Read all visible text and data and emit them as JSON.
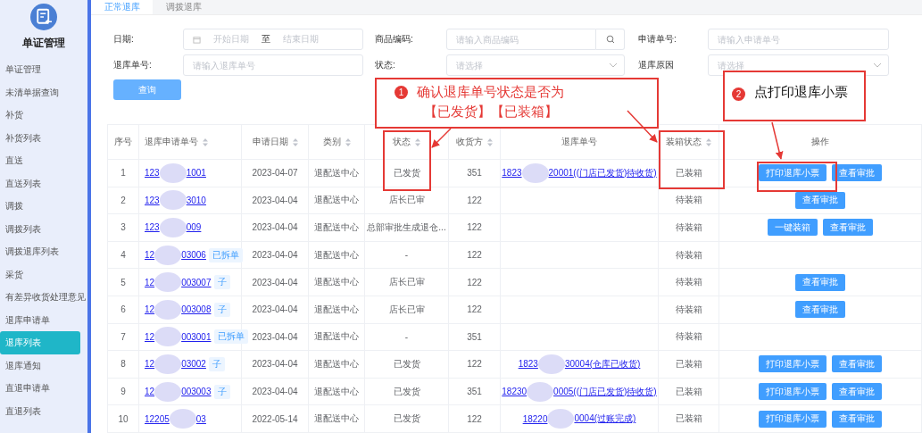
{
  "sidebar": {
    "title": "单证管理",
    "items": [
      {
        "label": "单证管理",
        "selected": false
      },
      {
        "label": "未清单据查询",
        "selected": false
      },
      {
        "label": "补货",
        "selected": false
      },
      {
        "label": "补货列表",
        "selected": false
      },
      {
        "label": "直送",
        "selected": false
      },
      {
        "label": "直送列表",
        "selected": false
      },
      {
        "label": "调拨",
        "selected": false
      },
      {
        "label": "调拨列表",
        "selected": false
      },
      {
        "label": "调拨退库列表",
        "selected": false
      },
      {
        "label": "采货",
        "selected": false
      },
      {
        "label": "有差异收货处理意见",
        "selected": false
      },
      {
        "label": "退库申请单",
        "selected": false
      },
      {
        "label": "退库列表",
        "selected": true
      },
      {
        "label": "退库通知",
        "selected": false
      },
      {
        "label": "直退申请单",
        "selected": false
      },
      {
        "label": "直退列表",
        "selected": false
      }
    ]
  },
  "tabs": [
    {
      "label": "正常退库",
      "selected": true
    },
    {
      "label": "调拨退库",
      "selected": false
    }
  ],
  "filters": {
    "date": {
      "label": "日期:",
      "start_placeholder": "开始日期",
      "separator": "至",
      "end_placeholder": "结束日期"
    },
    "product_code": {
      "label": "商品编码:",
      "placeholder": "请输入商品编码"
    },
    "request_no": {
      "label": "申请单号:",
      "placeholder": "请输入申请单号"
    },
    "return_no": {
      "label": "退库单号:",
      "placeholder": "请输入退库单号"
    },
    "status": {
      "label": "状态:",
      "placeholder": "请选择"
    },
    "reason": {
      "label": "退库原因",
      "placeholder": "请选择"
    },
    "query_button": "查询"
  },
  "table": {
    "columns": [
      {
        "label": "序号",
        "sortable": false
      },
      {
        "label": "退库申请单号",
        "sortable": true
      },
      {
        "label": "申请日期",
        "sortable": true
      },
      {
        "label": "类别",
        "sortable": true
      },
      {
        "label": "状态",
        "sortable": true
      },
      {
        "label": "收货方",
        "sortable": true
      },
      {
        "label": "退库单号",
        "sortable": false
      },
      {
        "label": "装箱状态",
        "sortable": true
      },
      {
        "label": "操作",
        "sortable": false
      }
    ],
    "rows": [
      {
        "no": "1",
        "request": [
          "123",
          "1001"
        ],
        "tag": "",
        "date": "2023-04-07",
        "category": "退配送中心",
        "status": "已发货",
        "receiver": "351",
        "return_no": [
          "1823",
          "20001((门店已发货)待收货)"
        ],
        "packing": "已装箱",
        "actions": [
          "打印退库小票",
          "查看审批"
        ]
      },
      {
        "no": "2",
        "request": [
          "123",
          "3010"
        ],
        "tag": "",
        "date": "2023-04-04",
        "category": "退配送中心",
        "status": "店长已审",
        "receiver": "122",
        "return_no": [],
        "packing": "待装箱",
        "actions": [
          "查看审批"
        ]
      },
      {
        "no": "3",
        "request": [
          "123",
          "009"
        ],
        "tag": "",
        "date": "2023-04-04",
        "category": "退配送中心",
        "status": "总部审批生成退仓...",
        "receiver": "122",
        "return_no": [],
        "packing": "待装箱",
        "actions": [
          "一键装箱",
          "查看审批"
        ]
      },
      {
        "no": "4",
        "request": [
          "12",
          "03006"
        ],
        "tag": "已拆单",
        "date": "2023-04-04",
        "category": "退配送中心",
        "status": "-",
        "receiver": "122",
        "return_no": [],
        "packing": "待装箱",
        "actions": []
      },
      {
        "no": "5",
        "request": [
          "12",
          "003007"
        ],
        "tag": "子",
        "date": "2023-04-04",
        "category": "退配送中心",
        "status": "店长已审",
        "receiver": "122",
        "return_no": [],
        "packing": "待装箱",
        "actions": [
          "查看审批"
        ]
      },
      {
        "no": "6",
        "request": [
          "12",
          "003008"
        ],
        "tag": "子",
        "date": "2023-04-04",
        "category": "退配送中心",
        "status": "店长已审",
        "receiver": "122",
        "return_no": [],
        "packing": "待装箱",
        "actions": [
          "查看审批"
        ]
      },
      {
        "no": "7",
        "request": [
          "12",
          "003001"
        ],
        "tag": "已拆单",
        "date": "2023-04-04",
        "category": "退配送中心",
        "status": "-",
        "receiver": "351",
        "return_no": [],
        "packing": "待装箱",
        "actions": []
      },
      {
        "no": "8",
        "request": [
          "12",
          "03002"
        ],
        "tag": "子",
        "date": "2023-04-04",
        "category": "退配送中心",
        "status": "已发货",
        "receiver": "122",
        "return_no": [
          "1823",
          "30004(仓库已收货)"
        ],
        "packing": "已装箱",
        "actions": [
          "打印退库小票",
          "查看审批"
        ]
      },
      {
        "no": "9",
        "request": [
          "12",
          "003003"
        ],
        "tag": "子",
        "date": "2023-04-04",
        "category": "退配送中心",
        "status": "已发货",
        "receiver": "351",
        "return_no": [
          "18230",
          "0005((门店已发货)待收货)"
        ],
        "packing": "已装箱",
        "actions": [
          "打印退库小票",
          "查看审批"
        ]
      },
      {
        "no": "10",
        "request": [
          "12205",
          "03"
        ],
        "tag": "",
        "date": "2022-05-14",
        "category": "退配送中心",
        "status": "已发货",
        "receiver": "122",
        "return_no": [
          "18220",
          "0004(过账完成)"
        ],
        "packing": "已装箱",
        "actions": [
          "打印退库小票",
          "查看审批"
        ]
      }
    ]
  },
  "callouts": [
    {
      "number": "1",
      "lines": [
        "确认退库单号状态是否为",
        "【已发货】【已装箱】"
      ]
    },
    {
      "number": "2",
      "lines": [
        "点打印退库小票"
      ]
    }
  ]
}
